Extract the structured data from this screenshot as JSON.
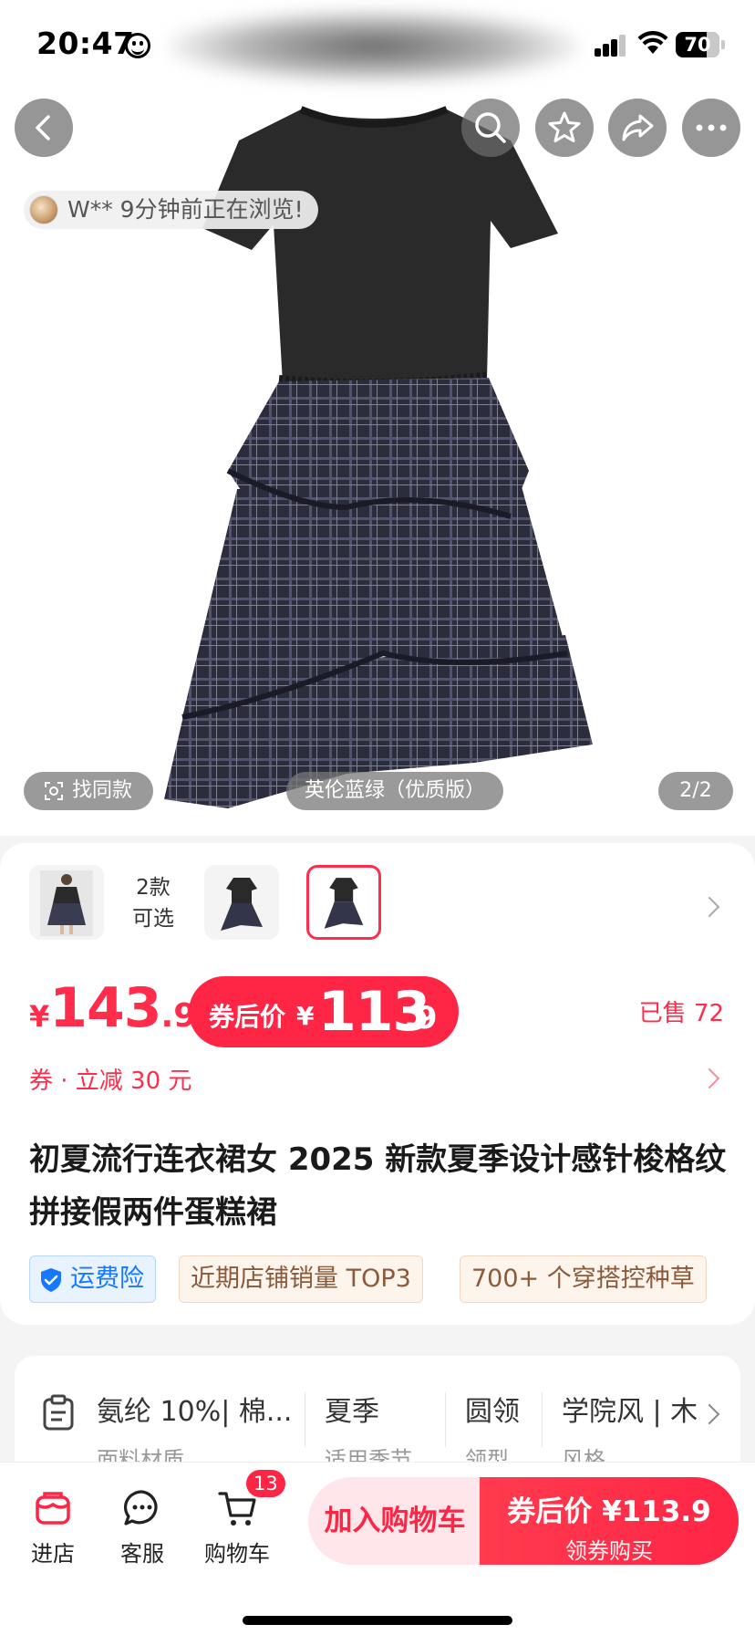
{
  "status_bar": {
    "time": "20:47",
    "battery": "70",
    "icons": [
      "emoji-face-icon",
      "signal-icon",
      "wifi-icon",
      "battery-icon"
    ]
  },
  "hero": {
    "nav_icons": [
      "back-icon",
      "search-icon",
      "star-icon",
      "share-icon",
      "more-icon"
    ],
    "browsing_notice": "W** 9分钟前正在浏览!",
    "find_same": "找同款",
    "variant_name": "英伦蓝绿（优质版）",
    "image_counter": "2/2"
  },
  "variants": {
    "count_label_line1": "2款",
    "count_label_line2": "可选"
  },
  "price": {
    "currency": "¥",
    "original_int": "143",
    "original_dec": ".9",
    "coupon_label": "券后价",
    "coupon_int": "113",
    "coupon_dec": ".9",
    "sold": "已售 72",
    "coupon_line": "券 · 立减 30 元"
  },
  "product": {
    "title": "初夏流行连衣裙女 2025 新款夏季设计感针梭格纹拼接假两件蛋糕裙",
    "tags": [
      "运费险",
      "近期店铺销量 TOP3",
      "700+ 个穿搭控种草"
    ]
  },
  "attributes": [
    {
      "value": "氨纶 10%| 棉...",
      "key": "面料材质"
    },
    {
      "value": "夏季",
      "key": "适用季节"
    },
    {
      "value": "圆领",
      "key": "领型"
    },
    {
      "value": "学院风 | 木",
      "key": "风格"
    }
  ],
  "bottom_bar": {
    "store": "进店",
    "service": "客服",
    "cart": "购物车",
    "cart_count": "13",
    "add_to_cart": "加入购物车",
    "buy_top": "券后价 ¥113.9",
    "buy_sub": "领券购买"
  },
  "colors": {
    "accent_red": "#ff2545",
    "tag_blue": "#1677ff",
    "tag_brown": "#8b5a3a"
  }
}
